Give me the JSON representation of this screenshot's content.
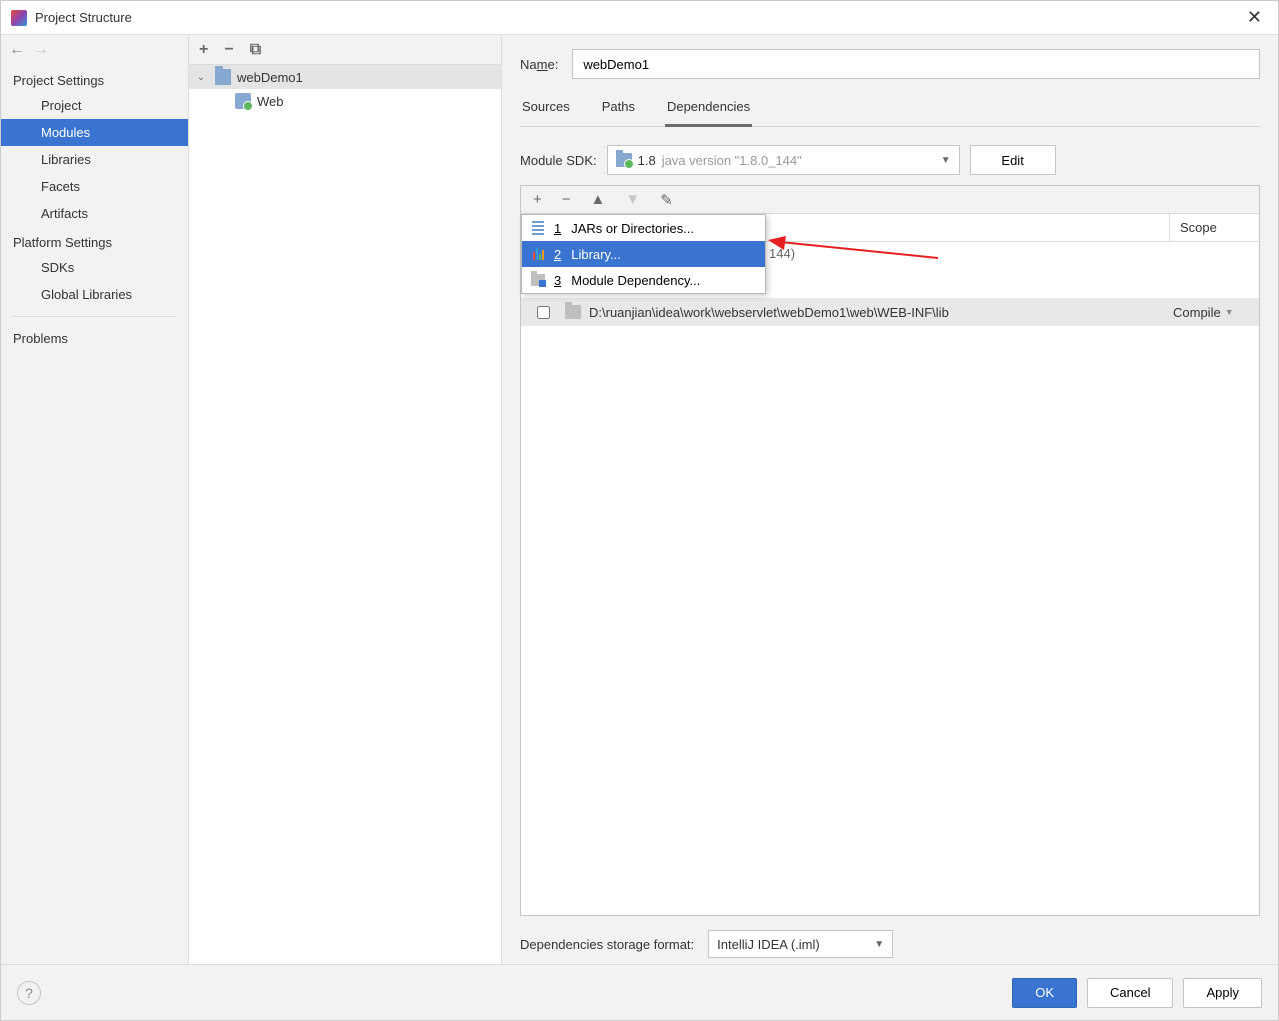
{
  "window": {
    "title": "Project Structure"
  },
  "sidebar": {
    "sections": [
      {
        "header": "Project Settings",
        "items": [
          {
            "label": "Project",
            "active": false
          },
          {
            "label": "Modules",
            "active": true
          },
          {
            "label": "Libraries",
            "active": false
          },
          {
            "label": "Facets",
            "active": false
          },
          {
            "label": "Artifacts",
            "active": false
          }
        ]
      },
      {
        "header": "Platform Settings",
        "items": [
          {
            "label": "SDKs",
            "active": false
          },
          {
            "label": "Global Libraries",
            "active": false
          }
        ]
      }
    ],
    "extra": {
      "label": "Problems"
    }
  },
  "tree": {
    "module": "webDemo1",
    "child": "Web"
  },
  "detail": {
    "name_label": "Name:",
    "name_value": "webDemo1",
    "tabs": [
      {
        "label": "Sources",
        "active": false
      },
      {
        "label": "Paths",
        "active": false
      },
      {
        "label": "Dependencies",
        "active": true
      }
    ],
    "sdk_label": "Module SDK:",
    "sdk_version": "1.8",
    "sdk_desc": "java version \"1.8.0_144\"",
    "edit_label": "Edit",
    "scope_header": "Scope",
    "hidden_row_tail": "144)",
    "dep_row": {
      "path": "D:\\ruanjian\\idea\\work\\webservlet\\webDemo1\\web\\WEB-INF\\lib",
      "scope": "Compile"
    },
    "popup": [
      {
        "num": "1",
        "label": "JARs or Directories...",
        "icon": "jar",
        "selected": false
      },
      {
        "num": "2",
        "label": "Library...",
        "icon": "lib",
        "selected": true
      },
      {
        "num": "3",
        "label": "Module Dependency...",
        "icon": "mod",
        "selected": false
      }
    ],
    "storage_label": "Dependencies storage format:",
    "storage_value": "IntelliJ IDEA (.iml)"
  },
  "footer": {
    "ok": "OK",
    "cancel": "Cancel",
    "apply": "Apply"
  }
}
